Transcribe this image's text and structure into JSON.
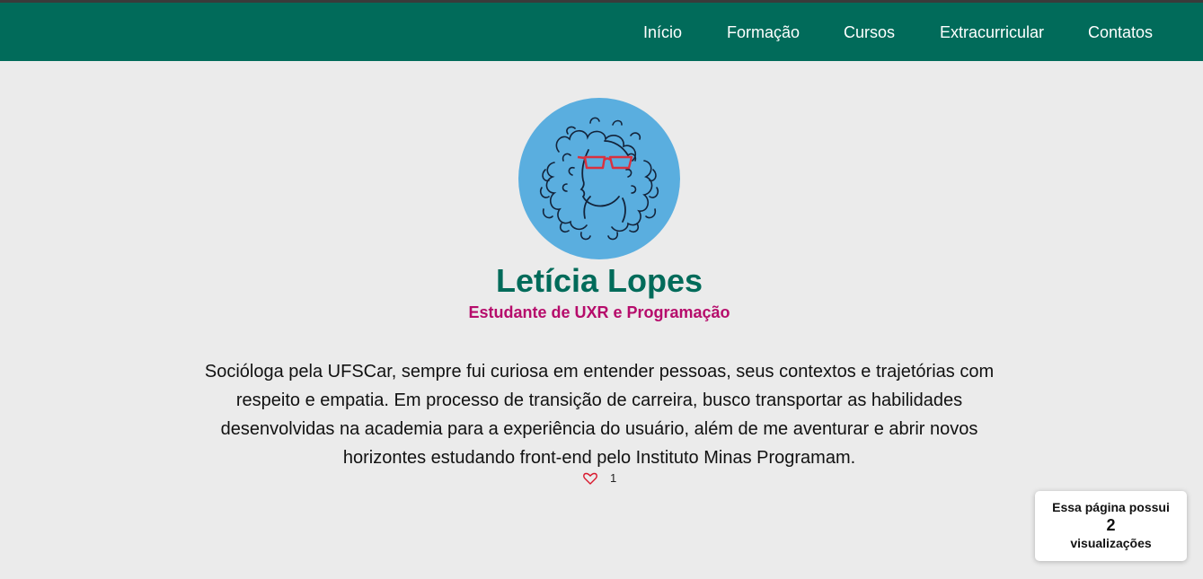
{
  "nav": {
    "items": [
      {
        "label": "Início"
      },
      {
        "label": "Formação"
      },
      {
        "label": "Cursos"
      },
      {
        "label": "Extracurricular"
      },
      {
        "label": "Contatos"
      }
    ]
  },
  "profile": {
    "avatar_icon": "curly-hair-woman-with-glasses-illustration",
    "name": "Letícia Lopes",
    "subtitle": "Estudante de UXR e Programação",
    "bio": "Socióloga pela UFSCar, sempre fui curiosa em entender pessoas, seus contextos e trajetórias com respeito e empatia. Em processo de transição de carreira, busco transportar as habilidades desenvolvidas na academia para a experiência do usuário, além de me aventurar e abrir novos horizontes estudando front-end pelo Instituto Minas Programam."
  },
  "likes": {
    "icon": "heart-outline-icon",
    "count": "1"
  },
  "views": {
    "prefix": "Essa página possui",
    "count": "2",
    "suffix": "visualizações"
  },
  "colors": {
    "nav_bg": "#016b5a",
    "page_bg": "#ebebeb",
    "name": "#016b5a",
    "subtitle": "#b60c6b",
    "avatar_bg": "#5aaedf",
    "heart": "#d9182d",
    "glasses": "#d9313f"
  }
}
